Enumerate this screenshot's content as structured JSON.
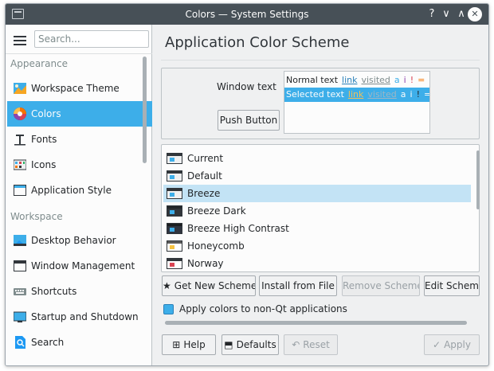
{
  "window": {
    "title": "Colors — System Settings"
  },
  "titlebar_buttons": {
    "help": "?",
    "minimize": "∨",
    "maximize": "∧",
    "close": "✕"
  },
  "sidebar": {
    "search_placeholder": "Search...",
    "sections": [
      {
        "label": "Appearance",
        "items": [
          "Workspace Theme",
          "Colors",
          "Fonts",
          "Icons",
          "Application Style"
        ]
      },
      {
        "label": "Workspace",
        "items": [
          "Desktop Behavior",
          "Window Management",
          "Shortcuts",
          "Startup and Shutdown",
          "Search"
        ]
      }
    ],
    "selected": "Colors"
  },
  "main": {
    "title": "Application Color Scheme",
    "preview": {
      "window_text_label": "Window text",
      "push_button_label": "Push Button",
      "normal_row": {
        "text": "Normal text",
        "link": "link",
        "visited": "visited",
        "a": "a",
        "i": "i",
        "bang": "!",
        "eq": "=",
        "plus": "+"
      },
      "selected_row": {
        "text": "Selected text",
        "link": "link",
        "visited": "visited",
        "a": "a",
        "i": "i",
        "bang": "!",
        "eq": "=",
        "plus": "+"
      }
    },
    "schemes": [
      {
        "name": "Current",
        "colors": [
          "#eff0f1",
          "#3daee9",
          "#31363b"
        ]
      },
      {
        "name": "Default",
        "colors": [
          "#eff0f1",
          "#3daee9",
          "#31363b"
        ]
      },
      {
        "name": "Breeze",
        "colors": [
          "#eff0f1",
          "#3daee9",
          "#31363b"
        ]
      },
      {
        "name": "Breeze Dark",
        "colors": [
          "#31363b",
          "#3daee9",
          "#232629"
        ]
      },
      {
        "name": "Breeze High Contrast",
        "colors": [
          "#2f343f",
          "#3daee9",
          "#1b1e20"
        ]
      },
      {
        "name": "Honeycomb",
        "colors": [
          "#5b5b5b",
          "#f6c342",
          "#ffffff"
        ]
      },
      {
        "name": "Norway",
        "colors": [
          "#ffffff",
          "#da4453",
          "#3daee9"
        ]
      }
    ],
    "selected_scheme": "Breeze",
    "buttons": {
      "get_new": "Get New Scheme",
      "install": "Install from File",
      "remove": "Remove Scheme",
      "edit": "Edit Scheme"
    },
    "apply_non_qt": "Apply colors to non-Qt applications"
  },
  "footer": {
    "help": "Help",
    "defaults": "Defaults",
    "reset": "Reset",
    "apply": "Apply"
  },
  "colors": {
    "accent": "#3daee9",
    "titlebar": "#475057",
    "selection_light": "#c3e3f5"
  }
}
